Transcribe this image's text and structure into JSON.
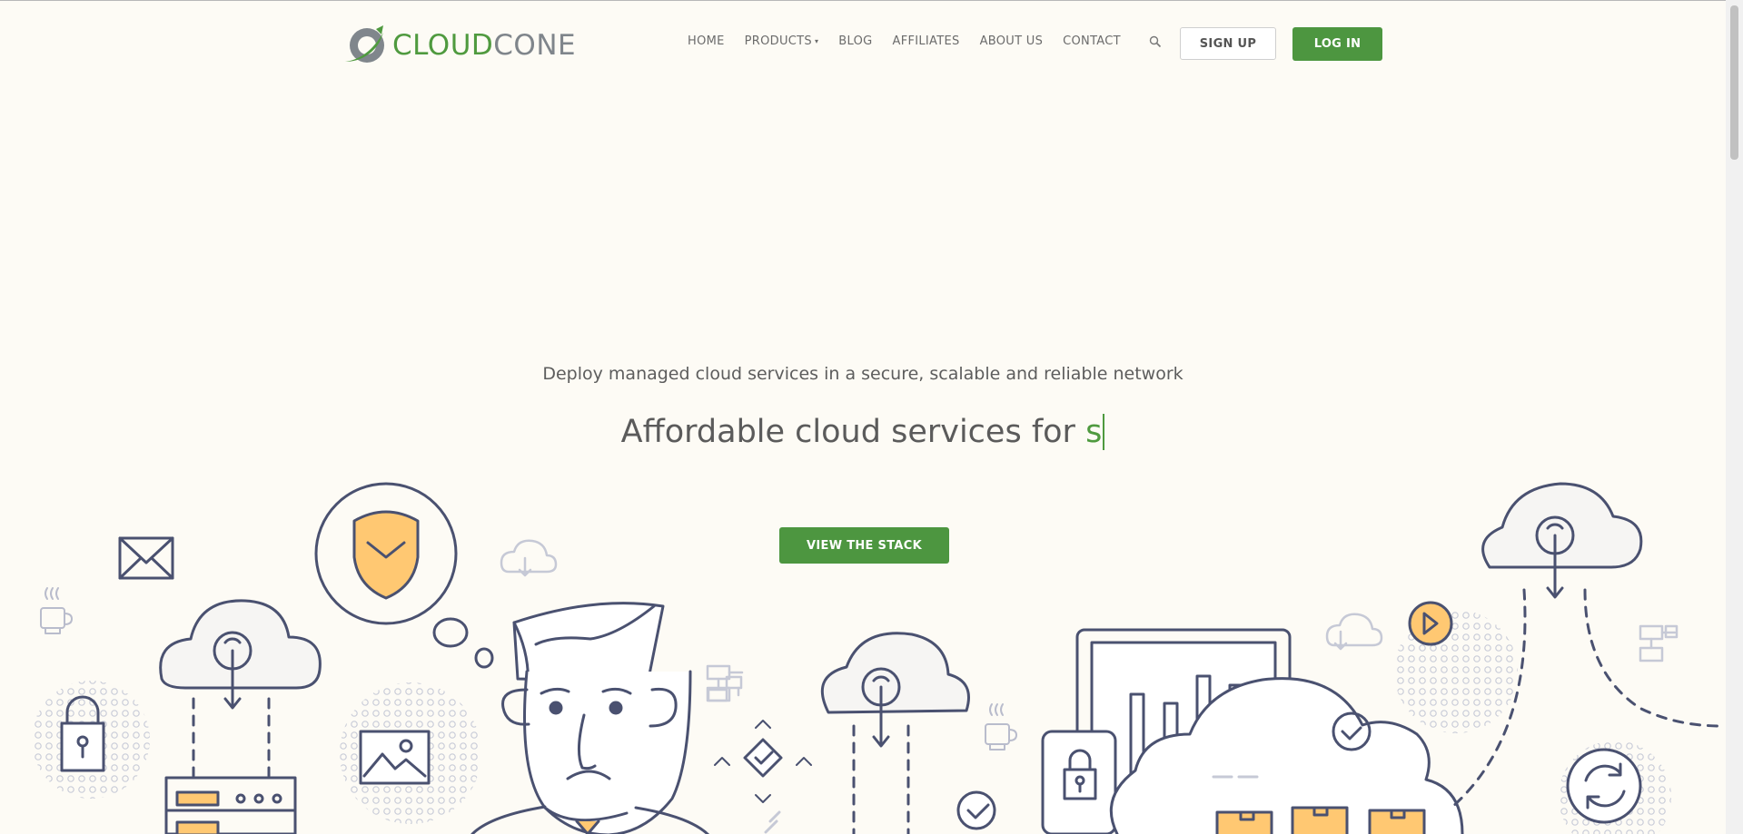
{
  "brand": {
    "name_part1": "CLOUD",
    "name_part2": "CONE"
  },
  "nav": {
    "items": [
      {
        "label": "HOME"
      },
      {
        "label": "PRODUCTS"
      },
      {
        "label": "BLOG"
      },
      {
        "label": "AFFILIATES"
      },
      {
        "label": "ABOUT US"
      },
      {
        "label": "CONTACT"
      }
    ],
    "signup_label": "SIGN UP",
    "login_label": "LOG IN"
  },
  "hero": {
    "tagline": "Deploy managed cloud services in a secure, scalable and reliable network",
    "headline": "Affordable cloud services for ",
    "typed_text": "s",
    "cta_label": "VIEW THE STACK"
  },
  "colors": {
    "brand_green": "#4d9640",
    "outline": "#4a5170",
    "accent_orange": "#ffc872",
    "background": "#fdfbf5"
  }
}
